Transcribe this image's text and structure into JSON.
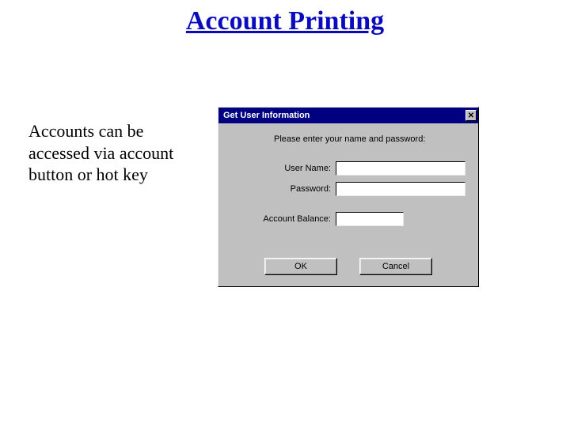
{
  "slide": {
    "title": "Account Printing",
    "body_text": "Accounts can be accessed via account button or hot key"
  },
  "dialog": {
    "title": "Get User Information",
    "close_glyph": "✕",
    "prompt": "Please enter your name and password:",
    "fields": {
      "user_name": {
        "label": "User Name:",
        "value": ""
      },
      "password": {
        "label": "Password:",
        "value": ""
      },
      "balance": {
        "label": "Account Balance:",
        "value": ""
      }
    },
    "buttons": {
      "ok": "OK",
      "cancel": "Cancel"
    }
  }
}
